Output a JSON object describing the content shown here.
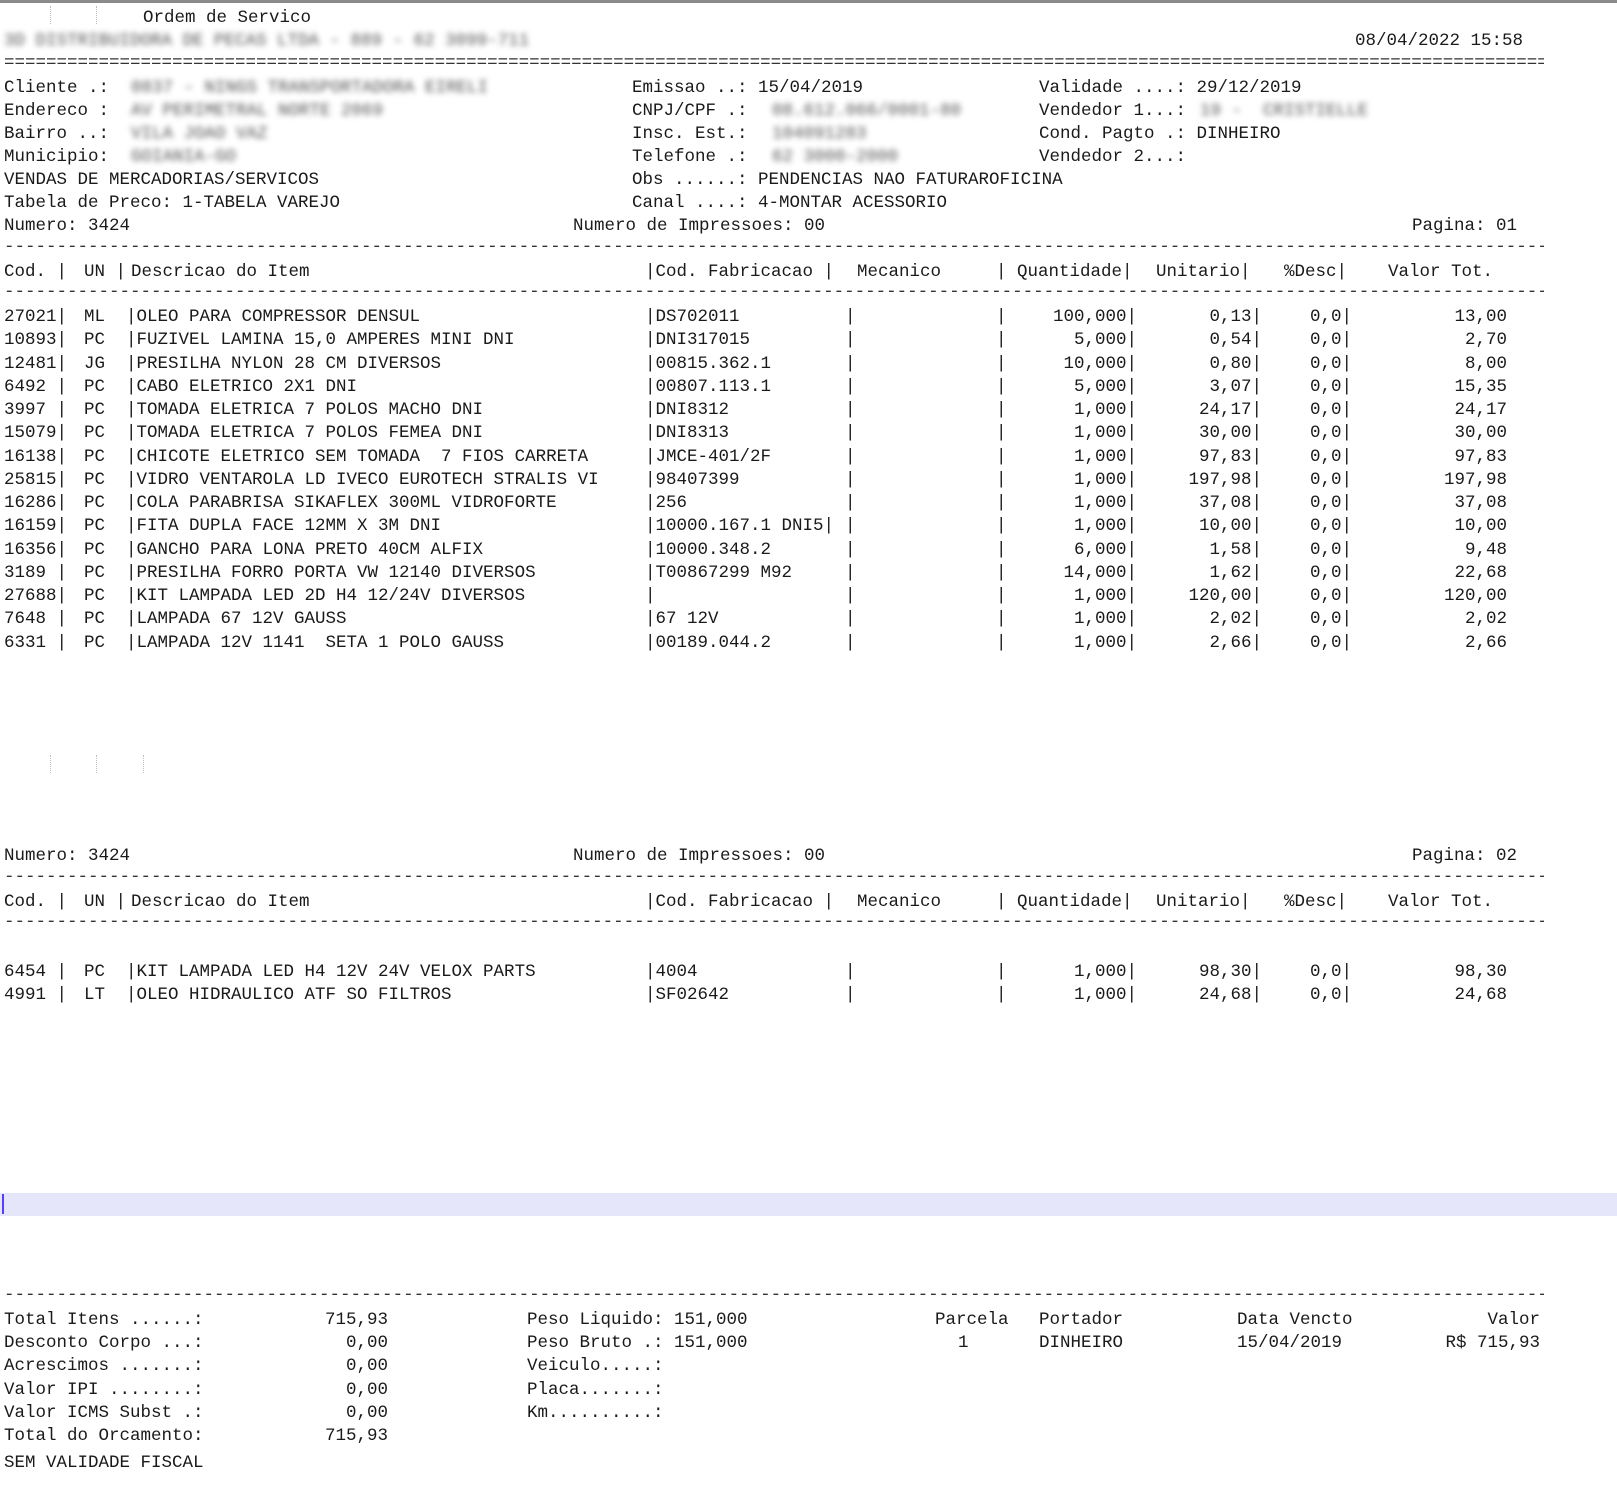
{
  "doc_title": "Ordem de Servico",
  "company_line": "3D DISTRIBUIDORA DE PECAS LTDA - 889 - 62 3099-711",
  "print_datetime": "08/04/2022 15:58",
  "header": {
    "cliente_label": "Cliente .:",
    "cliente_value": "0837 - NINGS TRANSPORTADORA EIRELI",
    "endereco_label": "Endereco :",
    "endereco_value": "AV PERIMETRAL NORTE 2069",
    "bairro_label": "Bairro ..:",
    "bairro_value": "VILA JOAO VAZ",
    "municipio_label": "Municipio:",
    "municipio_value": "GOIANIA-GO",
    "linha_vendas": "VENDAS DE MERCADORIAS/SERVICOS",
    "tabela_preco": "Tabela de Preco: 1-TABELA VAREJO",
    "emissao": "Emissao ..: 15/04/2019",
    "cnpj_label": "CNPJ/CPF .:",
    "cnpj_value": "08.612.066/0001-80",
    "insc_label": "Insc. Est.:",
    "insc_value": "104091283",
    "telefone_label": "Telefone .:",
    "telefone_value": "62 3000-2000",
    "obs": "Obs ......: PENDENCIAS NAO FATURAROFICINA",
    "canal": "Canal ....: 4-MONTAR ACESSORIO",
    "validade": "Validade ....: 29/12/2019",
    "vendedor1_label": "Vendedor 1...:",
    "vendedor1_value": "19 -  CRISTIELLE",
    "cond_pagto": "Cond. Pagto .: DINHEIRO",
    "vendedor2": "Vendedor 2...:"
  },
  "pages": [
    {
      "numero": "Numero: 3424",
      "impressoes": "Numero de Impressoes: 00",
      "pagina": "Pagina: 01"
    },
    {
      "numero": "Numero: 3424",
      "impressoes": "Numero de Impressoes: 00",
      "pagina": "Pagina: 02"
    }
  ],
  "columns": {
    "cod": "Cod. |",
    "un": "UN |",
    "desc": "Descricao do Item",
    "codfab": "|Cod. Fabricacao |",
    "mec": "Mecanico",
    "qtd": "| Quantidade|",
    "unit": "Unitario|",
    "desc_pct": "%Desc|",
    "valor": "Valor Tot."
  },
  "items_page1": [
    {
      "cod": "27021|",
      "un": "ML",
      "desc": "|OLEO PARA COMPRESSOR DENSUL",
      "codfab": "|DS702011",
      "qtd": "100,000|",
      "unit": "0,13|",
      "dpct": "0,0|",
      "valor": "13,00"
    },
    {
      "cod": "10893|",
      "un": "PC",
      "desc": "|FUZIVEL LAMINA 15,0 AMPERES MINI DNI",
      "codfab": "|DNI317015",
      "qtd": "5,000|",
      "unit": "0,54|",
      "dpct": "0,0|",
      "valor": "2,70"
    },
    {
      "cod": "12481|",
      "un": "JG",
      "desc": "|PRESILHA NYLON 28 CM DIVERSOS",
      "codfab": "|00815.362.1",
      "qtd": "10,000|",
      "unit": "0,80|",
      "dpct": "0,0|",
      "valor": "8,00"
    },
    {
      "cod": "6492 |",
      "un": "PC",
      "desc": "|CABO ELETRICO 2X1 DNI",
      "codfab": "|00807.113.1",
      "qtd": "5,000|",
      "unit": "3,07|",
      "dpct": "0,0|",
      "valor": "15,35"
    },
    {
      "cod": "3997 |",
      "un": "PC",
      "desc": "|TOMADA ELETRICA 7 POLOS MACHO DNI",
      "codfab": "|DNI8312",
      "qtd": "1,000|",
      "unit": "24,17|",
      "dpct": "0,0|",
      "valor": "24,17"
    },
    {
      "cod": "15079|",
      "un": "PC",
      "desc": "|TOMADA ELETRICA 7 POLOS FEMEA DNI",
      "codfab": "|DNI8313",
      "qtd": "1,000|",
      "unit": "30,00|",
      "dpct": "0,0|",
      "valor": "30,00"
    },
    {
      "cod": "16138|",
      "un": "PC",
      "desc": "|CHICOTE ELETRICO SEM TOMADA  7 FIOS CARRETA",
      "codfab": "|JMCE-401/2F",
      "qtd": "1,000|",
      "unit": "97,83|",
      "dpct": "0,0|",
      "valor": "97,83"
    },
    {
      "cod": "25815|",
      "un": "PC",
      "desc": "|VIDRO VENTAROLA LD IVECO EUROTECH STRALIS VI",
      "codfab": "|98407399",
      "qtd": "1,000|",
      "unit": "197,98|",
      "dpct": "0,0|",
      "valor": "197,98"
    },
    {
      "cod": "16286|",
      "un": "PC",
      "desc": "|COLA PARABRISA SIKAFLEX 300ML VIDROFORTE",
      "codfab": "|256",
      "qtd": "1,000|",
      "unit": "37,08|",
      "dpct": "0,0|",
      "valor": "37,08"
    },
    {
      "cod": "16159|",
      "un": "PC",
      "desc": "|FITA DUPLA FACE 12MM X 3M DNI",
      "codfab": "|10000.167.1 DNI5|",
      "qtd": "1,000|",
      "unit": "10,00|",
      "dpct": "0,0|",
      "valor": "10,00"
    },
    {
      "cod": "16356|",
      "un": "PC",
      "desc": "|GANCHO PARA LONA PRETO 40CM ALFIX",
      "codfab": "|10000.348.2",
      "qtd": "6,000|",
      "unit": "1,58|",
      "dpct": "0,0|",
      "valor": "9,48"
    },
    {
      "cod": "3189 |",
      "un": "PC",
      "desc": "|PRESILHA FORRO PORTA VW 12140 DIVERSOS",
      "codfab": "|T00867299 M92",
      "qtd": "14,000|",
      "unit": "1,62|",
      "dpct": "0,0|",
      "valor": "22,68"
    },
    {
      "cod": "27688|",
      "un": "PC",
      "desc": "|KIT LAMPADA LED 2D H4 12/24V DIVERSOS",
      "codfab": "|",
      "qtd": "1,000|",
      "unit": "120,00|",
      "dpct": "0,0|",
      "valor": "120,00"
    },
    {
      "cod": "7648 |",
      "un": "PC",
      "desc": "|LAMPADA 67 12V GAUSS",
      "codfab": "|67 12V",
      "qtd": "1,000|",
      "unit": "2,02|",
      "dpct": "0,0|",
      "valor": "2,02"
    },
    {
      "cod": "6331 |",
      "un": "PC",
      "desc": "|LAMPADA 12V 1141  SETA 1 POLO GAUSS",
      "codfab": "|00189.044.2",
      "qtd": "1,000|",
      "unit": "2,66|",
      "dpct": "0,0|",
      "valor": "2,66"
    }
  ],
  "items_page2": [
    {
      "cod": "6454 |",
      "un": "PC",
      "desc": "|KIT LAMPADA LED H4 12V 24V VELOX PARTS",
      "codfab": "|4004",
      "qtd": "1,000|",
      "unit": "98,30|",
      "dpct": "0,0|",
      "valor": "98,30"
    },
    {
      "cod": "4991 |",
      "un": "LT",
      "desc": "|OLEO HIDRAULICO ATF SO FILTROS",
      "codfab": "|SF02642",
      "qtd": "1,000|",
      "unit": "24,68|",
      "dpct": "0,0|",
      "valor": "24,68"
    }
  ],
  "totals": [
    {
      "label": "Total Itens ......:",
      "value": "715,93"
    },
    {
      "label": "Desconto Corpo ...:",
      "value": "0,00"
    },
    {
      "label": "Acrescimos .......:",
      "value": "0,00"
    },
    {
      "label": "Valor IPI ........:",
      "value": "0,00"
    },
    {
      "label": "Valor ICMS Subst .:",
      "value": "0,00"
    },
    {
      "label": "Total do Orcamento:",
      "value": "715,93"
    }
  ],
  "sem_validade": "SEM VALIDADE FISCAL",
  "peso": [
    "Peso Liquido: 151,000",
    "Peso Bruto .: 151,000",
    "Veiculo.....:",
    "Placa.......:",
    "Km..........:"
  ],
  "parcelas": {
    "h_parcela": "Parcela",
    "h_portador": "Portador",
    "h_data": "Data Vencto",
    "h_valor": "Valor",
    "parcela": "1",
    "portador": "DINHEIRO",
    "data": "15/04/2019",
    "valor": "R$ 715,93"
  }
}
